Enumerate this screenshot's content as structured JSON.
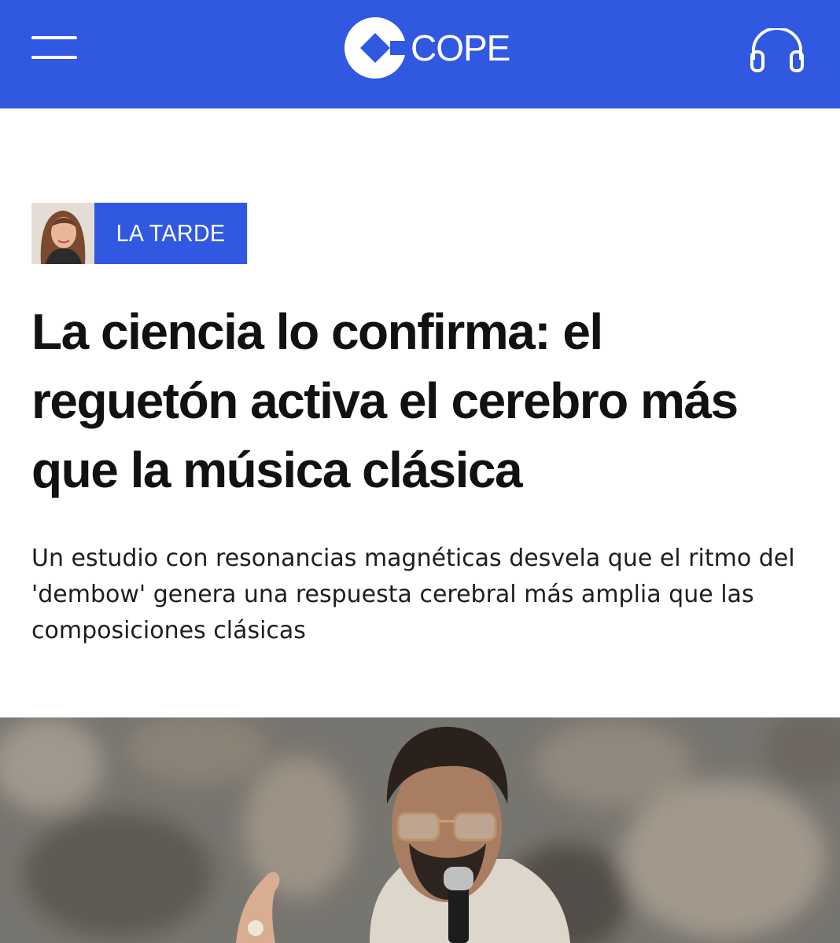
{
  "header": {
    "brand": "COPE",
    "menu_icon": "hamburger-menu-icon",
    "audio_icon": "headphones-icon",
    "background_color": "#3158e0"
  },
  "article": {
    "program_tag": "LA TARDE",
    "headline": "La ciencia lo confirma: el reguetón activa el cerebro más que la música clásica",
    "subtitle": "Un estudio con resonancias magnéticas desvela que el ritmo del 'dembow' genera una respuesta cerebral más amplia que las composiciones clásicas"
  }
}
